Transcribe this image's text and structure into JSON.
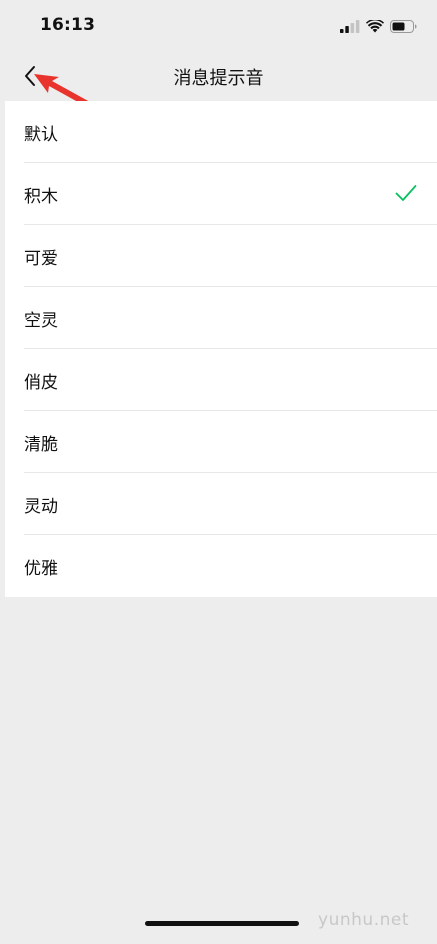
{
  "status_bar": {
    "time": "16:13",
    "icons": [
      "signal-icon",
      "wifi-icon",
      "battery-icon"
    ]
  },
  "nav": {
    "back_icon": "chevron-left-icon",
    "title": "消息提示音"
  },
  "sound_list": {
    "items": [
      {
        "label": "默认",
        "selected": false
      },
      {
        "label": "积木",
        "selected": true
      },
      {
        "label": "可爱",
        "selected": false
      },
      {
        "label": "空灵",
        "selected": false
      },
      {
        "label": "俏皮",
        "selected": false
      },
      {
        "label": "清脆",
        "selected": false
      },
      {
        "label": "灵动",
        "selected": false
      },
      {
        "label": "优雅",
        "selected": false
      }
    ],
    "check_icon": "checkmark-icon"
  },
  "annotation": {
    "icon": "red-arrow-icon"
  },
  "watermark": "yunhu.net",
  "colors": {
    "background": "#ededed",
    "list_background": "#ffffff",
    "check": "#07c160",
    "annotation_arrow": "#e8342c",
    "watermark": "#c8c8c8"
  }
}
